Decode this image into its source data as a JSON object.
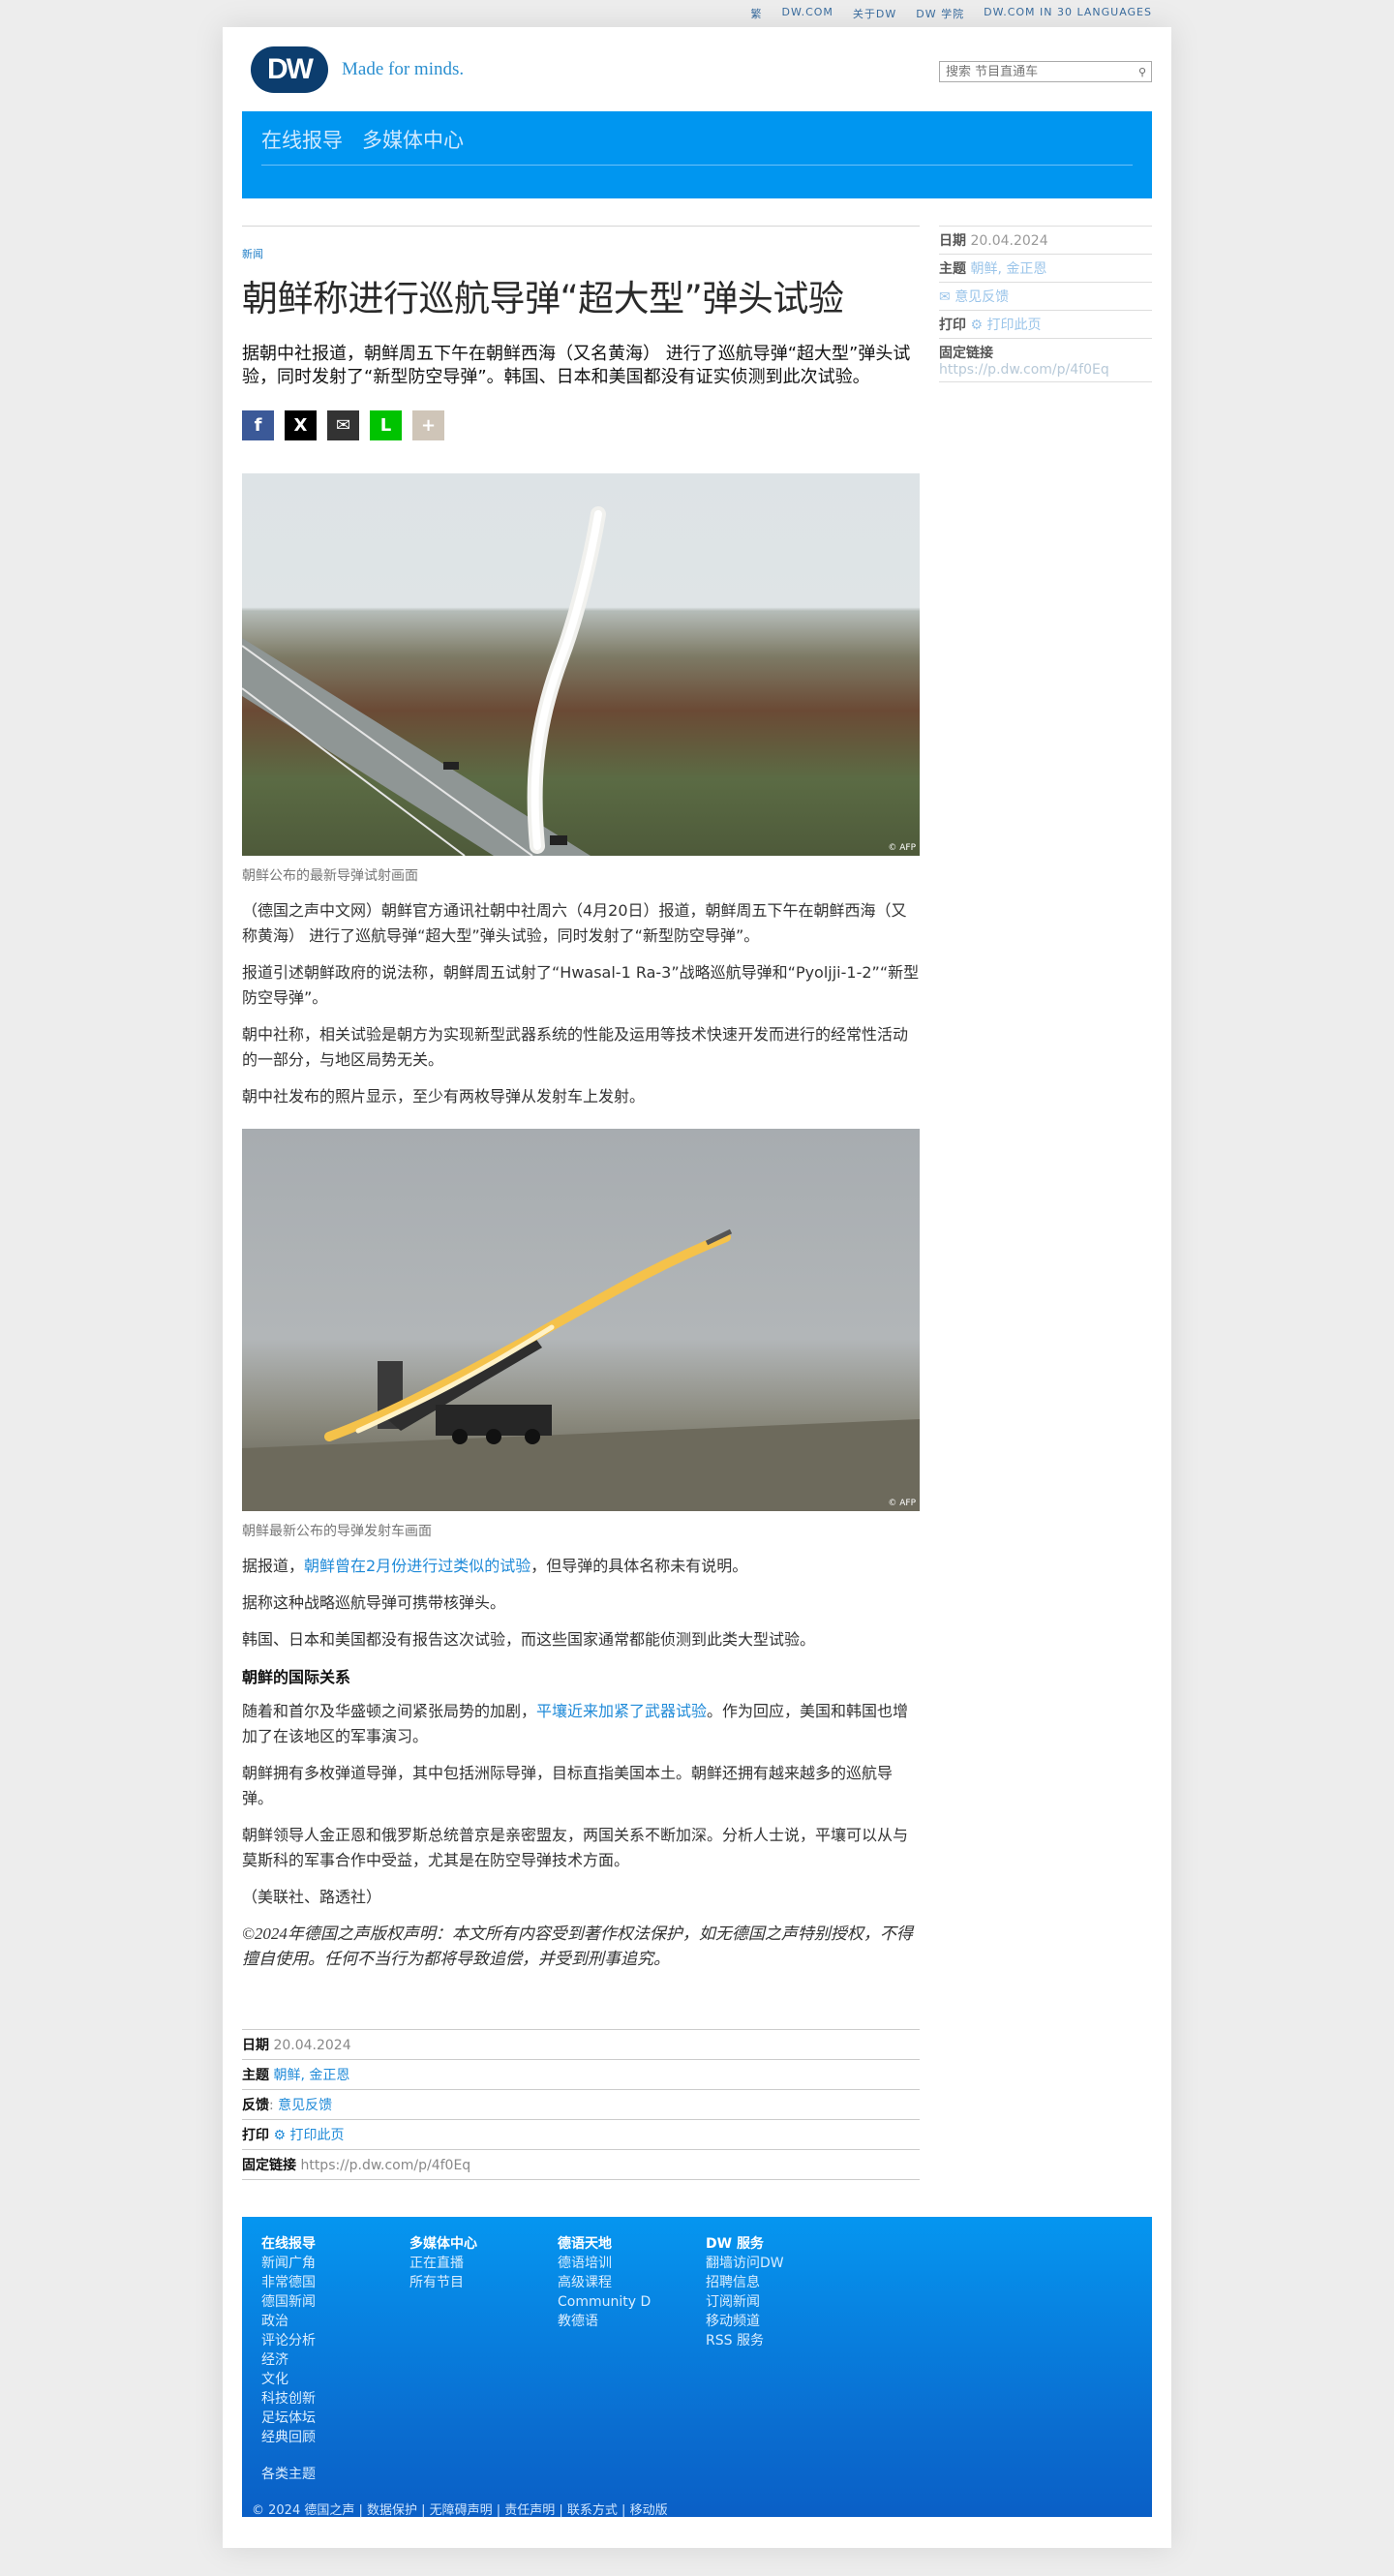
{
  "topbar": {
    "links": [
      "繁",
      "DW.COM",
      "关于DW",
      "DW 学院",
      "DW.COM IN 30 LANGUAGES"
    ]
  },
  "logo": {
    "mark": "DW",
    "tagline": "Made for minds."
  },
  "search": {
    "placeholder": "搜索 节目直通车"
  },
  "nav": {
    "items": [
      "在线报导",
      "多媒体中心"
    ]
  },
  "article": {
    "kicker": "新闻",
    "title": "朝鲜称进行巡航导弹“超大型”弹头试验",
    "lead": "据朝中社报道，朝鲜周五下午在朝鲜西海（又名黄海） 进行了巡航导弹“超大型”弹头试验，同时发射了“新型防空导弹”。韩国、日本和美国都没有证实侦测到此次试验。",
    "share": [
      "f",
      "X",
      "✉",
      "L",
      "+"
    ],
    "image1": {
      "credit": "© AFP",
      "caption": "朝鲜公布的最新导弹试射画面"
    },
    "p1": "（德国之声中文网）朝鲜官方通讯社朝中社周六（4月20日）报道，朝鲜周五下午在朝鲜西海（又称黄海） 进行了巡航导弹“超大型”弹头试验，同时发射了“新型防空导弹”。",
    "p2": "报道引述朝鲜政府的说法称，朝鲜周五试射了“Hwasal-1 Ra-3”战略巡航导弹和“Pyoljji-1-2”“新型防空导弹”。",
    "p3": "朝中社称，相关试验是朝方为实现新型武器系统的性能及运用等技术快速开发而进行的经常性活动的一部分，与地区局势无关。",
    "p4": "朝中社发布的照片显示，至少有两枚导弹从发射车上发射。",
    "image2": {
      "credit": "© AFP",
      "caption": "朝鲜最新公布的导弹发射车画面"
    },
    "p5_pre": "据报道，",
    "p5_link": "朝鲜曾在2月份进行过类似的试验",
    "p5_post": "，但导弹的具体名称未有说明。",
    "p6": "据称这种战略巡航导弹可携带核弹头。",
    "p7": "韩国、日本和美国都没有报告这次试验，而这些国家通常都能侦测到此类大型试验。",
    "h_relations": "朝鲜的国际关系",
    "p8_pre": "随着和首尔及华盛顿之间紧张局势的加剧，",
    "p8_link": "平壤近来加紧了武器试验",
    "p8_post": "。作为回应，美国和韩国也增加了在该地区的军事演习。",
    "p9": "朝鲜拥有多枚弹道导弹，其中包括洲际导弹，目标直指美国本土。朝鲜还拥有越来越多的巡航导弹。",
    "p10": "朝鲜领导人金正恩和俄罗斯总统普京是亲密盟友，两国关系不断加深。分析人士说，平壤可以从与莫斯科的军事合作中受益，尤其是在防空导弹技术方面。",
    "source": "（美联社、路透社）",
    "copyright": "©2024年德国之声版权声明：本文所有内容受到著作权法保护，如无德国之声特别授权，不得擅自使用。任何不当行为都将导致追偿，并受到刑事追究。"
  },
  "meta": {
    "date_label": "日期",
    "date": "20.04.2024",
    "topics_label": "主题",
    "topics": "朝鲜, 金正恩",
    "feedback_label": "反馈",
    "feedback_side": "意见反馈",
    "feedback": "意见反馈",
    "print_label": "打印",
    "print": "打印此页",
    "permalink_label": "固定链接",
    "permalink": "https://p.dw.com/p/4f0Eq"
  },
  "footer": {
    "cols": [
      {
        "head": "在线报导",
        "items": [
          "新闻广角",
          "非常德国",
          "德国新闻",
          "政治",
          "评论分析",
          "经济",
          "文化",
          "科技创新",
          "足坛体坛",
          "经典回顾"
        ]
      },
      {
        "head": "多媒体中心",
        "items": [
          "正在直播",
          "所有节目"
        ]
      },
      {
        "head": "德语天地",
        "items": [
          "德语培训",
          "高级课程",
          "Community D",
          "教德语"
        ]
      },
      {
        "head": "DW 服务",
        "items": [
          "翻墙访问DW",
          "招聘信息",
          "订阅新闻",
          "移动频道",
          "RSS 服务"
        ]
      }
    ],
    "all_topics": "各类主题",
    "bottom": "© 2024 德国之声 | 数据保护 | 无障碍声明 | 责任声明 | 联系方式 | 移动版"
  }
}
